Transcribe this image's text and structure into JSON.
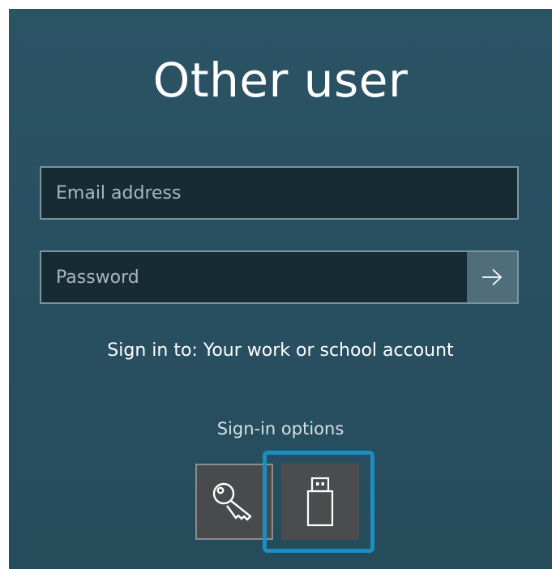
{
  "title": "Other user",
  "email": {
    "placeholder": "Email address",
    "value": ""
  },
  "password": {
    "placeholder": "Password",
    "value": "",
    "submit_icon": "arrow-right-icon"
  },
  "sign_in_to": "Sign in to: Your work or school account",
  "sign_in_options": {
    "label": "Sign-in options",
    "options": [
      {
        "icon": "key-icon",
        "selected": false
      },
      {
        "icon": "usb-security-key-icon",
        "selected": true
      }
    ],
    "focus_color": "#1b8fc2"
  },
  "colors": {
    "background": "#2a5364",
    "field_background": "#172b34",
    "field_border": "#7a94a0",
    "submit_background": "#4f6d7a",
    "option_background": "#484a4c"
  }
}
